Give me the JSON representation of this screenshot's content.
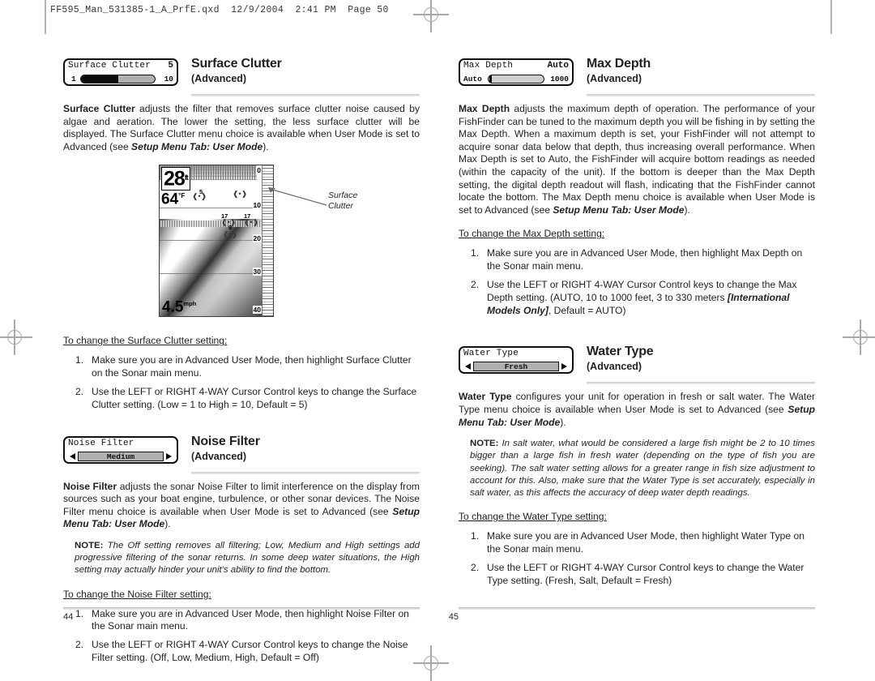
{
  "print_header": "FF595_Man_531385-1_A_PrfE.qxd  12/9/2004  2:41 PM  Page 50",
  "left_page_number": "44",
  "right_page_number": "45",
  "sections": {
    "surface_clutter": {
      "title": "Surface Clutter",
      "subtitle": "(Advanced)",
      "widget": {
        "type": "slider",
        "label": "Surface Clutter",
        "value": "5",
        "min_label": "1",
        "max_label": "10",
        "fill_percent": 50
      },
      "body": "Surface Clutter adjusts the filter that removes surface clutter noise caused by algae and aeration. The lower the setting, the less surface clutter will be displayed. The Surface Clutter menu choice is available when User Mode is set to Advanced (see Setup Menu Tab: User Mode).",
      "figure": {
        "callout": "Surface\nClutter",
        "depth": "28",
        "depth_unit": "ft",
        "temperature": "64",
        "temperature_unit": "°F",
        "speed": "4.5",
        "speed_unit": "mph",
        "scale_labels": [
          "0",
          "10",
          "20",
          "30",
          "40"
        ],
        "fish_labels": [
          "5",
          "17",
          "9",
          "17"
        ]
      },
      "instructions_heading": "To change the Surface Clutter setting:",
      "steps": [
        "Make sure you are in Advanced User Mode, then highlight Surface Clutter on the Sonar main menu.",
        "Use the LEFT or RIGHT 4-WAY Cursor Control keys to change the Surface Clutter setting. (Low = 1 to High = 10, Default = 5)"
      ]
    },
    "noise_filter": {
      "title": "Noise Filter",
      "subtitle": "(Advanced)",
      "widget": {
        "type": "option",
        "label": "Noise Filter",
        "value": "Medium"
      },
      "body": "Noise Filter adjusts the sonar Noise Filter to limit interference on the display from sources such as your boat engine, turbulence, or other sonar devices. The Noise Filter menu choice is available when User Mode is set to Advanced (see Setup Menu Tab: User Mode).",
      "note_label": "NOTE:",
      "note": "The Off setting removes all filtering; Low, Medium and High settings add progressive filtering of the sonar returns. In some deep water situations, the High setting may actually hinder your unit's ability to find the bottom.",
      "instructions_heading": "To change the Noise Filter setting:",
      "steps": [
        "Make sure you are in Advanced User Mode, then highlight Noise Filter on the Sonar main menu.",
        "Use the LEFT or RIGHT 4-WAY Cursor Control keys to change the Noise Filter setting. (Off, Low, Medium, High, Default = Off)"
      ]
    },
    "max_depth": {
      "title": "Max Depth",
      "subtitle": "(Advanced)",
      "widget": {
        "type": "slider",
        "label": "Max Depth",
        "value": "Auto",
        "min_label": "Auto",
        "max_label": "1000",
        "fill_percent": 0
      },
      "body": "Max Depth adjusts the maximum depth of operation. The performance of your FishFinder can be tuned to the maximum depth you will be fishing in by setting the Max Depth. When a maximum depth is set, your FishFinder will not attempt to acquire sonar data below that depth, thus increasing overall performance. When Max Depth is set to Auto, the FishFinder will acquire bottom readings as needed (within the capacity of the unit). If the bottom is deeper than the Max Depth setting, the digital depth readout will flash, indicating that the FishFinder cannot locate the bottom. The Max Depth menu choice is available when User Mode is set to Advanced (see Setup Menu Tab: User Mode).",
      "instructions_heading": "To change the Max Depth setting:",
      "steps": [
        "Make sure you are in Advanced User Mode, then highlight Max Depth on the Sonar main menu.",
        "Use the LEFT or RIGHT 4-WAY Cursor Control keys to change the Max Depth setting. (AUTO, 10 to 1000 feet, 3 to 330 meters [International Models Only], Default = AUTO)"
      ]
    },
    "water_type": {
      "title": "Water Type",
      "subtitle": "(Advanced)",
      "widget": {
        "type": "option",
        "label": "Water Type",
        "value": "Fresh"
      },
      "body": "Water Type configures your unit for operation in fresh or salt water. The Water Type menu choice is available when User Mode is set to Advanced (see Setup Menu Tab: User Mode).",
      "note_label": "NOTE:",
      "note": "In salt water, what would be considered a large fish might be 2 to 10 times bigger than a large fish in fresh water (depending on the type of fish you are seeking).  The salt water setting allows for a greater range in fish size adjustment to account for this.  Also, make sure that the Water Type is set accurately, especially in salt water, as this affects the accuracy of deep water depth readings.",
      "instructions_heading": "To change the Water Type setting:",
      "steps": [
        "Make sure you are in Advanced User Mode, then highlight Water Type on the Sonar main menu.",
        "Use the LEFT or RIGHT 4-WAY Cursor Control keys to change the Water Type setting. (Fresh, Salt, Default = Fresh)"
      ]
    }
  }
}
